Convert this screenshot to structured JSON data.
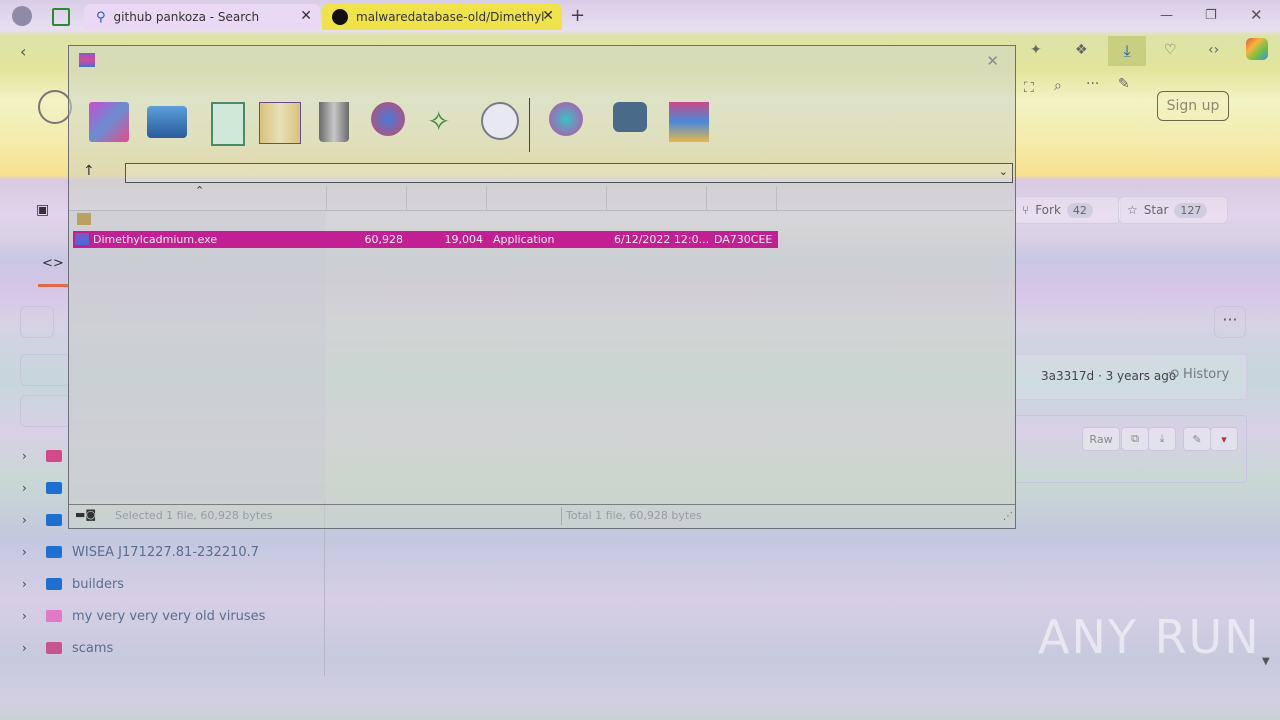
{
  "browser": {
    "tabs": [
      {
        "title": "github pankoza - Search"
      },
      {
        "title": "malwaredatabase-old/Dimethyl"
      }
    ]
  },
  "github": {
    "signup_label": "Sign up",
    "fork_label": "Fork",
    "fork_count": "42",
    "star_label": "Star",
    "star_count": "127",
    "commit_info": "3a3317d · 3 years ago",
    "history_label": "History",
    "raw_label": "Raw",
    "tree": [
      {
        "label": ""
      },
      {
        "label": ""
      },
      {
        "label": ""
      },
      {
        "label": "WISEA J171227.81-232210.7"
      },
      {
        "label": "builders"
      },
      {
        "label": "my very very very old viruses"
      },
      {
        "label": "scams"
      }
    ],
    "watermark": "ANY RUN"
  },
  "archiver": {
    "path": "",
    "file": {
      "name": "Dimethylcadmium.exe",
      "size": "60,928",
      "packed": "19,004",
      "type": "Application",
      "modified": "6/12/2022 12:0...",
      "crc": "DA730CEE"
    },
    "status_left": "Selected 1 file, 60,928 bytes",
    "status_right": "Total 1 file, 60,928 bytes"
  }
}
